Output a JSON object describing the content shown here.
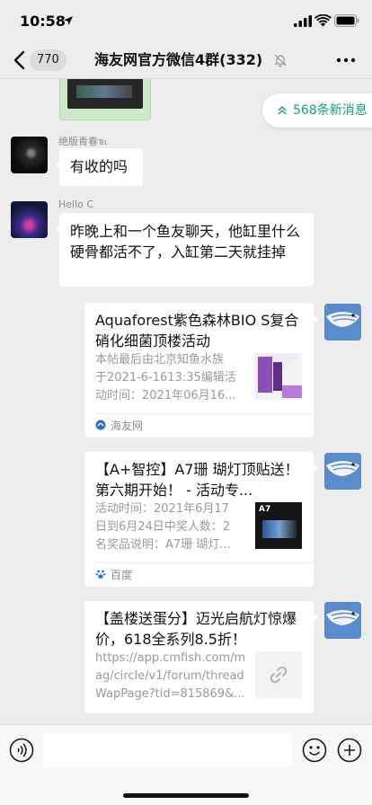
{
  "status_bar": {
    "time": "10:58"
  },
  "nav": {
    "back_count": "770",
    "title": "海友网官方微信4群(332)"
  },
  "new_messages": {
    "label": "568条新消息"
  },
  "messages": [
    {
      "sender": "绝版青春℡",
      "text": "有收的吗"
    },
    {
      "sender": "Hello C",
      "text": "昨晚上和一个鱼友聊天，他缸里什么硬骨都活不了，入缸第二天就挂掉"
    }
  ],
  "cards": [
    {
      "title": "Aquaforest紫色森林BIO S复合硝化细菌顶楼活动",
      "desc": [
        "本帖最后由北京知鱼水族",
        "于2021-6-1613:35编辑活",
        "动时间：2021年06月16..."
      ],
      "source": "海友网"
    },
    {
      "title": "【A+智控】A7珊 瑚灯顶贴送！第六期开始！ - 活动专...",
      "desc": [
        "活动时间：2021年6月17",
        "日到6月24日中奖人数：2",
        "名奖品说明：A7珊 瑚灯..."
      ],
      "thumb_text": "A7",
      "source": "百度"
    },
    {
      "title": "【盖楼送蛋分】迈光启航灯惊爆价，618全系列8.5折！",
      "desc": [
        "https://app.cmfish.com/m",
        "ag/circle/v1/forum/thread",
        "WapPage?tid=815869&..."
      ]
    }
  ],
  "colors": {
    "background": "#ededed",
    "accent_green": "#12a571",
    "link_blue": "#2f6fd6"
  },
  "icons": [
    "location-arrow-icon",
    "signal-icon",
    "wifi-icon",
    "battery-icon",
    "back-chevron-icon",
    "mute-bell-icon",
    "more-icon",
    "double-chevron-up-icon",
    "link-icon",
    "voice-icon",
    "emoji-icon",
    "plus-icon"
  ]
}
